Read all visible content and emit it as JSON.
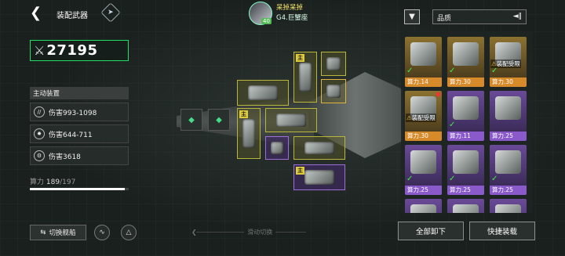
{
  "header": {
    "title": "装配武器"
  },
  "player": {
    "name": "呆掉呆掉",
    "ship": "G4.巨蟹座",
    "level": "40"
  },
  "power": {
    "value": "27195"
  },
  "active": {
    "header": "主动装置",
    "skills": [
      "伤害993-1098",
      "伤害644-711",
      "伤害3618"
    ]
  },
  "compute": {
    "label": "算力",
    "used": "189",
    "total": "/197",
    "fraction": 0.959
  },
  "bottom": {
    "switch_ship": "切换舰船",
    "slide_hint": "滑动切换",
    "unload_all": "全部卸下",
    "quick_equip": "快捷装载"
  },
  "filter": {
    "quality_label": "品质"
  },
  "slots": {
    "main_tag": "主"
  },
  "inventory": [
    {
      "power": "算力.14",
      "rarity": "gold",
      "equipped": true,
      "warn": ""
    },
    {
      "power": "算力.30",
      "rarity": "gold",
      "equipped": true,
      "warn": ""
    },
    {
      "power": "算力.30",
      "rarity": "gold",
      "equipped": true,
      "warn": "装配受限"
    },
    {
      "power": "算力.30",
      "rarity": "gold",
      "equipped": false,
      "warn": "装配受限"
    },
    {
      "power": "算力.11",
      "rarity": "purple",
      "equipped": true,
      "warn": ""
    },
    {
      "power": "算力.25",
      "rarity": "purple",
      "equipped": false,
      "warn": ""
    },
    {
      "power": "算力.25",
      "rarity": "purple",
      "equipped": true,
      "warn": ""
    },
    {
      "power": "算力.25",
      "rarity": "purple",
      "equipped": true,
      "warn": ""
    },
    {
      "power": "算力.25",
      "rarity": "purple",
      "equipped": true,
      "warn": ""
    },
    {
      "power": "",
      "rarity": "purple",
      "equipped": false,
      "warn": ""
    },
    {
      "power": "",
      "rarity": "purple",
      "equipped": false,
      "warn": ""
    },
    {
      "power": "",
      "rarity": "purple",
      "equipped": false,
      "warn": ""
    }
  ]
}
